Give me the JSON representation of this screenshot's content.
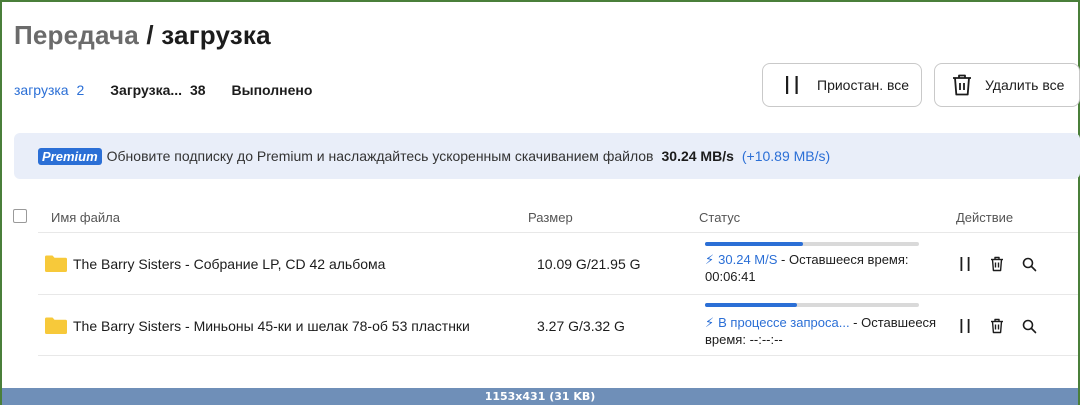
{
  "breadcrumb": {
    "parent": "Передача",
    "separator": "/",
    "current": "загрузка"
  },
  "tabs": [
    {
      "label": "загрузка",
      "count": "2",
      "active": true
    },
    {
      "label": "Загрузка...",
      "count": "38",
      "active": false
    },
    {
      "label": "Выполнено",
      "count": "",
      "active": false
    }
  ],
  "toolbar": {
    "pause_all_label": "Приостан. все",
    "delete_all_label": "Удалить все"
  },
  "banner": {
    "badge": "Premium",
    "text": "Обновите подписку до Premium и наслаждайтесь ускоренным скачиванием файлов",
    "speed": "30.24 MB/s",
    "bonus": "(+10.89 MB/s)"
  },
  "table": {
    "headers": {
      "name": "Имя файла",
      "size": "Размер",
      "status": "Статус",
      "action": "Действие"
    },
    "rows": [
      {
        "name": "The Barry Sisters - Собрание LP, CD 42 альбома",
        "size": "10.09 G/21.95 G",
        "progress": 0.46,
        "status_primary": "30.24 M/S",
        "status_secondary": " - Оставшееся время:",
        "status_line2": "00:06:41"
      },
      {
        "name": "The Barry Sisters - Миньоны 45-ки и шелак 78-об 53 пластнки",
        "size": "3.27 G/3.32 G",
        "progress": 0.43,
        "status_primary": "В процессе запроса...",
        "status_secondary": " - Оставшееся",
        "status_line2": "время: --:--:--"
      }
    ]
  },
  "footer": {
    "text": "1153x431 (31 KB)"
  },
  "colors": {
    "accent": "#2b6fd6",
    "folder": "#f7c93a",
    "banner_bg": "#e9eef9"
  }
}
